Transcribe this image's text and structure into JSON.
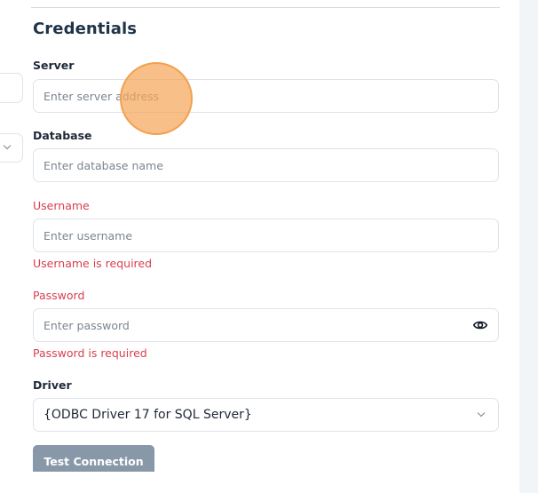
{
  "section_title": "Credentials",
  "server": {
    "label": "Server",
    "placeholder": "Enter server address"
  },
  "database": {
    "label": "Database",
    "placeholder": "Enter database name"
  },
  "username": {
    "label": "Username",
    "placeholder": "Enter username",
    "error": "Username is required"
  },
  "password": {
    "label": "Password",
    "placeholder": "Enter password",
    "error": "Password is required",
    "toggle_icon": "eye-icon"
  },
  "driver": {
    "label": "Driver",
    "value": "{ODBC Driver 17 for SQL Server}"
  },
  "test_connection_label": "Test Connection",
  "colors": {
    "heading": "#1f3349",
    "error": "#d9404f",
    "button": "#8898a8",
    "touch": "#f5a65a"
  }
}
